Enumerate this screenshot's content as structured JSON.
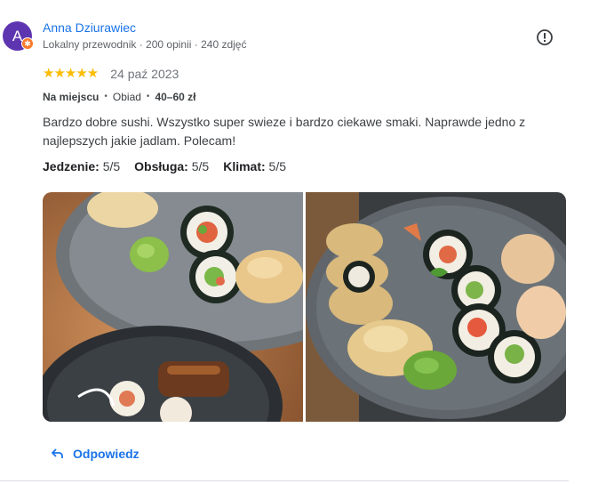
{
  "reviewer": {
    "avatar_letter": "A",
    "name": "Anna Dziurawiec",
    "meta": "Lokalny przewodnik · 200 opinii · 240 zdjęć"
  },
  "review": {
    "stars": "★★★★★",
    "rating": 5,
    "date": "24 paź 2023",
    "attributes": [
      {
        "label": "Na miejscu",
        "bold": true
      },
      {
        "label": "Obiad",
        "bold": false
      },
      {
        "label": "40–60 zł",
        "bold": true
      }
    ],
    "text": "Bardzo dobre sushi. Wszystko super swieze i bardzo ciekawe smaki. Naprawde jedno z najlepszych jakie jadlam. Polecam!",
    "scores": [
      {
        "label": "Jedzenie:",
        "value": "5/5"
      },
      {
        "label": "Obsługa:",
        "value": "5/5"
      },
      {
        "label": "Klimat:",
        "value": "5/5"
      }
    ]
  },
  "actions": {
    "reply_label": "Odpowiedz",
    "flag_icon": "flag-icon",
    "reply_icon": "reply-arrow-icon"
  },
  "colors": {
    "accent": "#1a73e8",
    "star": "#fbbc04",
    "avatar": "#5e35b1",
    "badge": "#f97a2b"
  }
}
